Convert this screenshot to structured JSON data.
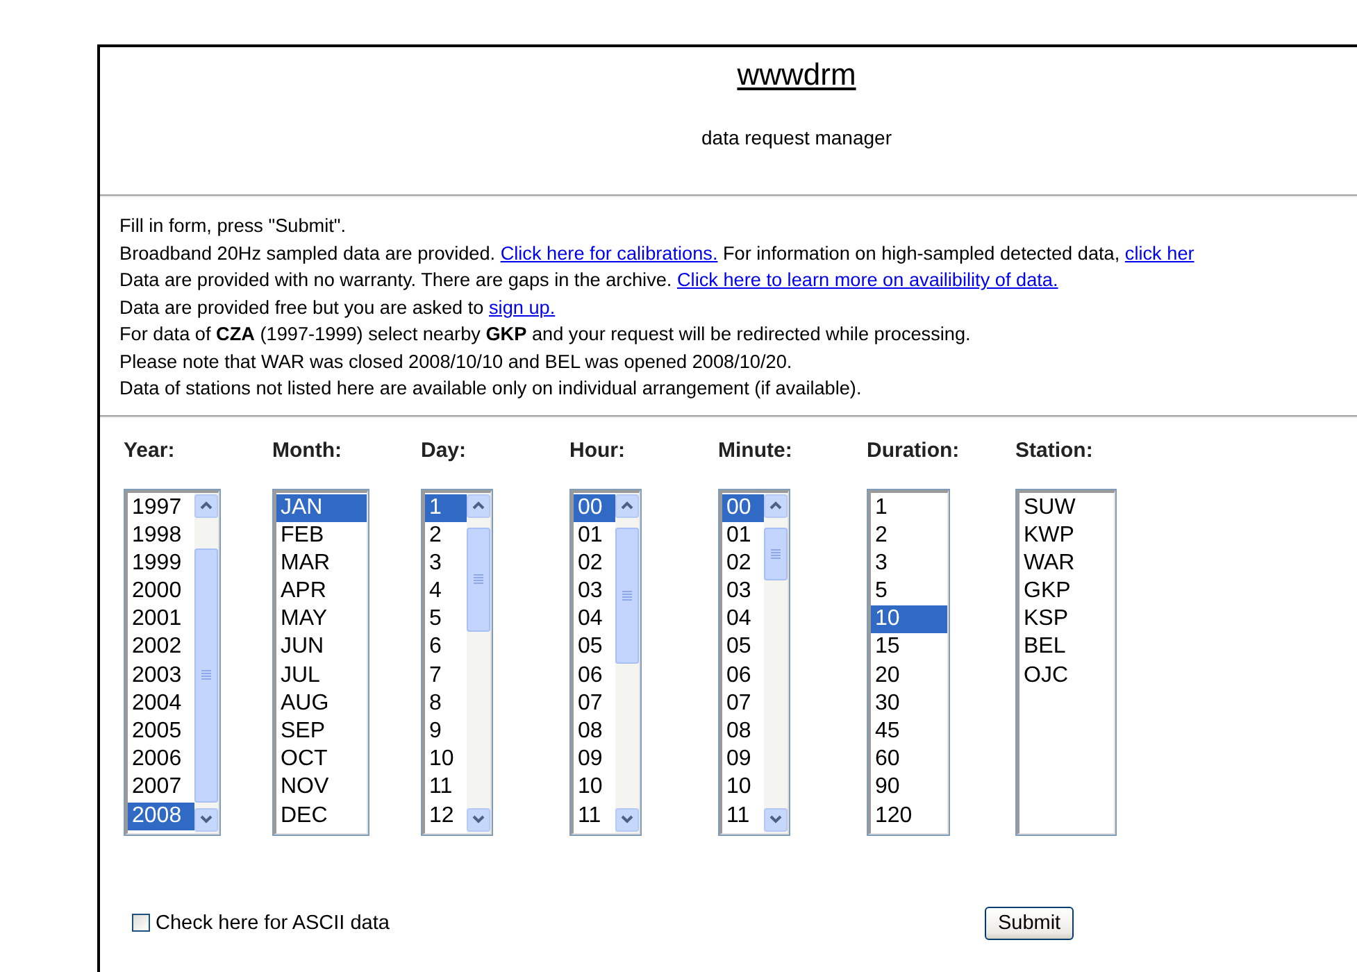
{
  "title": "wwwdrm",
  "subtitle": "data request manager",
  "notes": [
    [
      {
        "kind": "text",
        "text": "Fill in form, press \"Submit\"."
      }
    ],
    [
      {
        "kind": "text",
        "text": "Broadband 20Hz sampled data are provided. "
      },
      {
        "kind": "link",
        "text": "Click here for calibrations."
      },
      {
        "kind": "text",
        "text": " For information on high-sampled detected data, "
      },
      {
        "kind": "link",
        "text": "click her"
      }
    ],
    [
      {
        "kind": "text",
        "text": "Data are provided with no warranty. There are gaps in the archive. "
      },
      {
        "kind": "link",
        "text": "Click here to learn more on availibility of data."
      }
    ],
    [
      {
        "kind": "text",
        "text": "Data are provided free but you are asked to "
      },
      {
        "kind": "link",
        "text": "sign up."
      }
    ],
    [
      {
        "kind": "text",
        "text": "For data of **CZA** (1997-1999) select nearby **GKP** and your request will be redirected while processing."
      }
    ],
    [
      {
        "kind": "text",
        "text": "Please note that WAR was closed 2008/10/10 and BEL was opened 2008/10/20."
      }
    ],
    [
      {
        "kind": "text",
        "text": "Data of stations not listed here are available only on individual arrangement (if available)."
      }
    ]
  ],
  "fields": [
    {
      "label": "Year:",
      "kind": "scrolling",
      "options": [
        {
          "text": "1997",
          "selected": false
        },
        {
          "text": "1998",
          "selected": false
        },
        {
          "text": "1999",
          "selected": false
        },
        {
          "text": "2000",
          "selected": false
        },
        {
          "text": "2001",
          "selected": false
        },
        {
          "text": "2002",
          "selected": false
        },
        {
          "text": "2003",
          "selected": false
        },
        {
          "text": "2004",
          "selected": false
        },
        {
          "text": "2005",
          "selected": false
        },
        {
          "text": "2006",
          "selected": false
        },
        {
          "text": "2007",
          "selected": false
        },
        {
          "text": "2008",
          "selected": true
        }
      ]
    },
    {
      "label": "Month:",
      "kind": "plain",
      "options": [
        {
          "text": "JAN",
          "selected": true
        },
        {
          "text": "FEB",
          "selected": false
        },
        {
          "text": "MAR",
          "selected": false
        },
        {
          "text": "APR",
          "selected": false
        },
        {
          "text": "MAY",
          "selected": false
        },
        {
          "text": "JUN",
          "selected": false
        },
        {
          "text": "JUL",
          "selected": false
        },
        {
          "text": "AUG",
          "selected": false
        },
        {
          "text": "SEP",
          "selected": false
        },
        {
          "text": "OCT",
          "selected": false
        },
        {
          "text": "NOV",
          "selected": false
        },
        {
          "text": "DEC",
          "selected": false
        }
      ]
    },
    {
      "label": "Day:",
      "kind": "scrolling",
      "options": [
        {
          "text": "1",
          "selected": true
        },
        {
          "text": "2",
          "selected": false
        },
        {
          "text": "3",
          "selected": false
        },
        {
          "text": "4",
          "selected": false
        },
        {
          "text": "5",
          "selected": false
        },
        {
          "text": "6",
          "selected": false
        },
        {
          "text": "7",
          "selected": false
        },
        {
          "text": "8",
          "selected": false
        },
        {
          "text": "9",
          "selected": false
        },
        {
          "text": "10",
          "selected": false
        },
        {
          "text": "11",
          "selected": false
        },
        {
          "text": "12",
          "selected": false
        }
      ]
    },
    {
      "label": "Hour:",
      "kind": "scrolling",
      "options": [
        {
          "text": "00",
          "selected": true
        },
        {
          "text": "01",
          "selected": false
        },
        {
          "text": "02",
          "selected": false
        },
        {
          "text": "03",
          "selected": false
        },
        {
          "text": "04",
          "selected": false
        },
        {
          "text": "05",
          "selected": false
        },
        {
          "text": "06",
          "selected": false
        },
        {
          "text": "07",
          "selected": false
        },
        {
          "text": "08",
          "selected": false
        },
        {
          "text": "09",
          "selected": false
        },
        {
          "text": "10",
          "selected": false
        },
        {
          "text": "11",
          "selected": false
        }
      ]
    },
    {
      "label": "Minute:",
      "kind": "scrolling",
      "options": [
        {
          "text": "00",
          "selected": true
        },
        {
          "text": "01",
          "selected": false
        },
        {
          "text": "02",
          "selected": false
        },
        {
          "text": "03",
          "selected": false
        },
        {
          "text": "04",
          "selected": false
        },
        {
          "text": "05",
          "selected": false
        },
        {
          "text": "06",
          "selected": false
        },
        {
          "text": "07",
          "selected": false
        },
        {
          "text": "08",
          "selected": false
        },
        {
          "text": "09",
          "selected": false
        },
        {
          "text": "10",
          "selected": false
        },
        {
          "text": "11",
          "selected": false
        }
      ]
    },
    {
      "label": "Duration:",
      "kind": "plain",
      "options": [
        {
          "text": "1",
          "selected": false
        },
        {
          "text": "2",
          "selected": false
        },
        {
          "text": "3",
          "selected": false
        },
        {
          "text": "5",
          "selected": false
        },
        {
          "text": "10",
          "selected": true
        },
        {
          "text": "15",
          "selected": false
        },
        {
          "text": "20",
          "selected": false
        },
        {
          "text": "30",
          "selected": false
        },
        {
          "text": "45",
          "selected": false
        },
        {
          "text": "60",
          "selected": false
        },
        {
          "text": "90",
          "selected": false
        },
        {
          "text": "120",
          "selected": false
        }
      ]
    },
    {
      "label": "Station:",
      "kind": "plain",
      "options": [
        {
          "text": "SUW",
          "selected": false
        },
        {
          "text": "KWP",
          "selected": false
        },
        {
          "text": "WAR",
          "selected": false
        },
        {
          "text": "GKP",
          "selected": false
        },
        {
          "text": "KSP",
          "selected": false
        },
        {
          "text": "BEL",
          "selected": false
        },
        {
          "text": "OJC",
          "selected": false
        }
      ]
    }
  ],
  "ascii": {
    "label": "Check here for ASCII data",
    "checked": false
  },
  "submit": "Submit"
}
